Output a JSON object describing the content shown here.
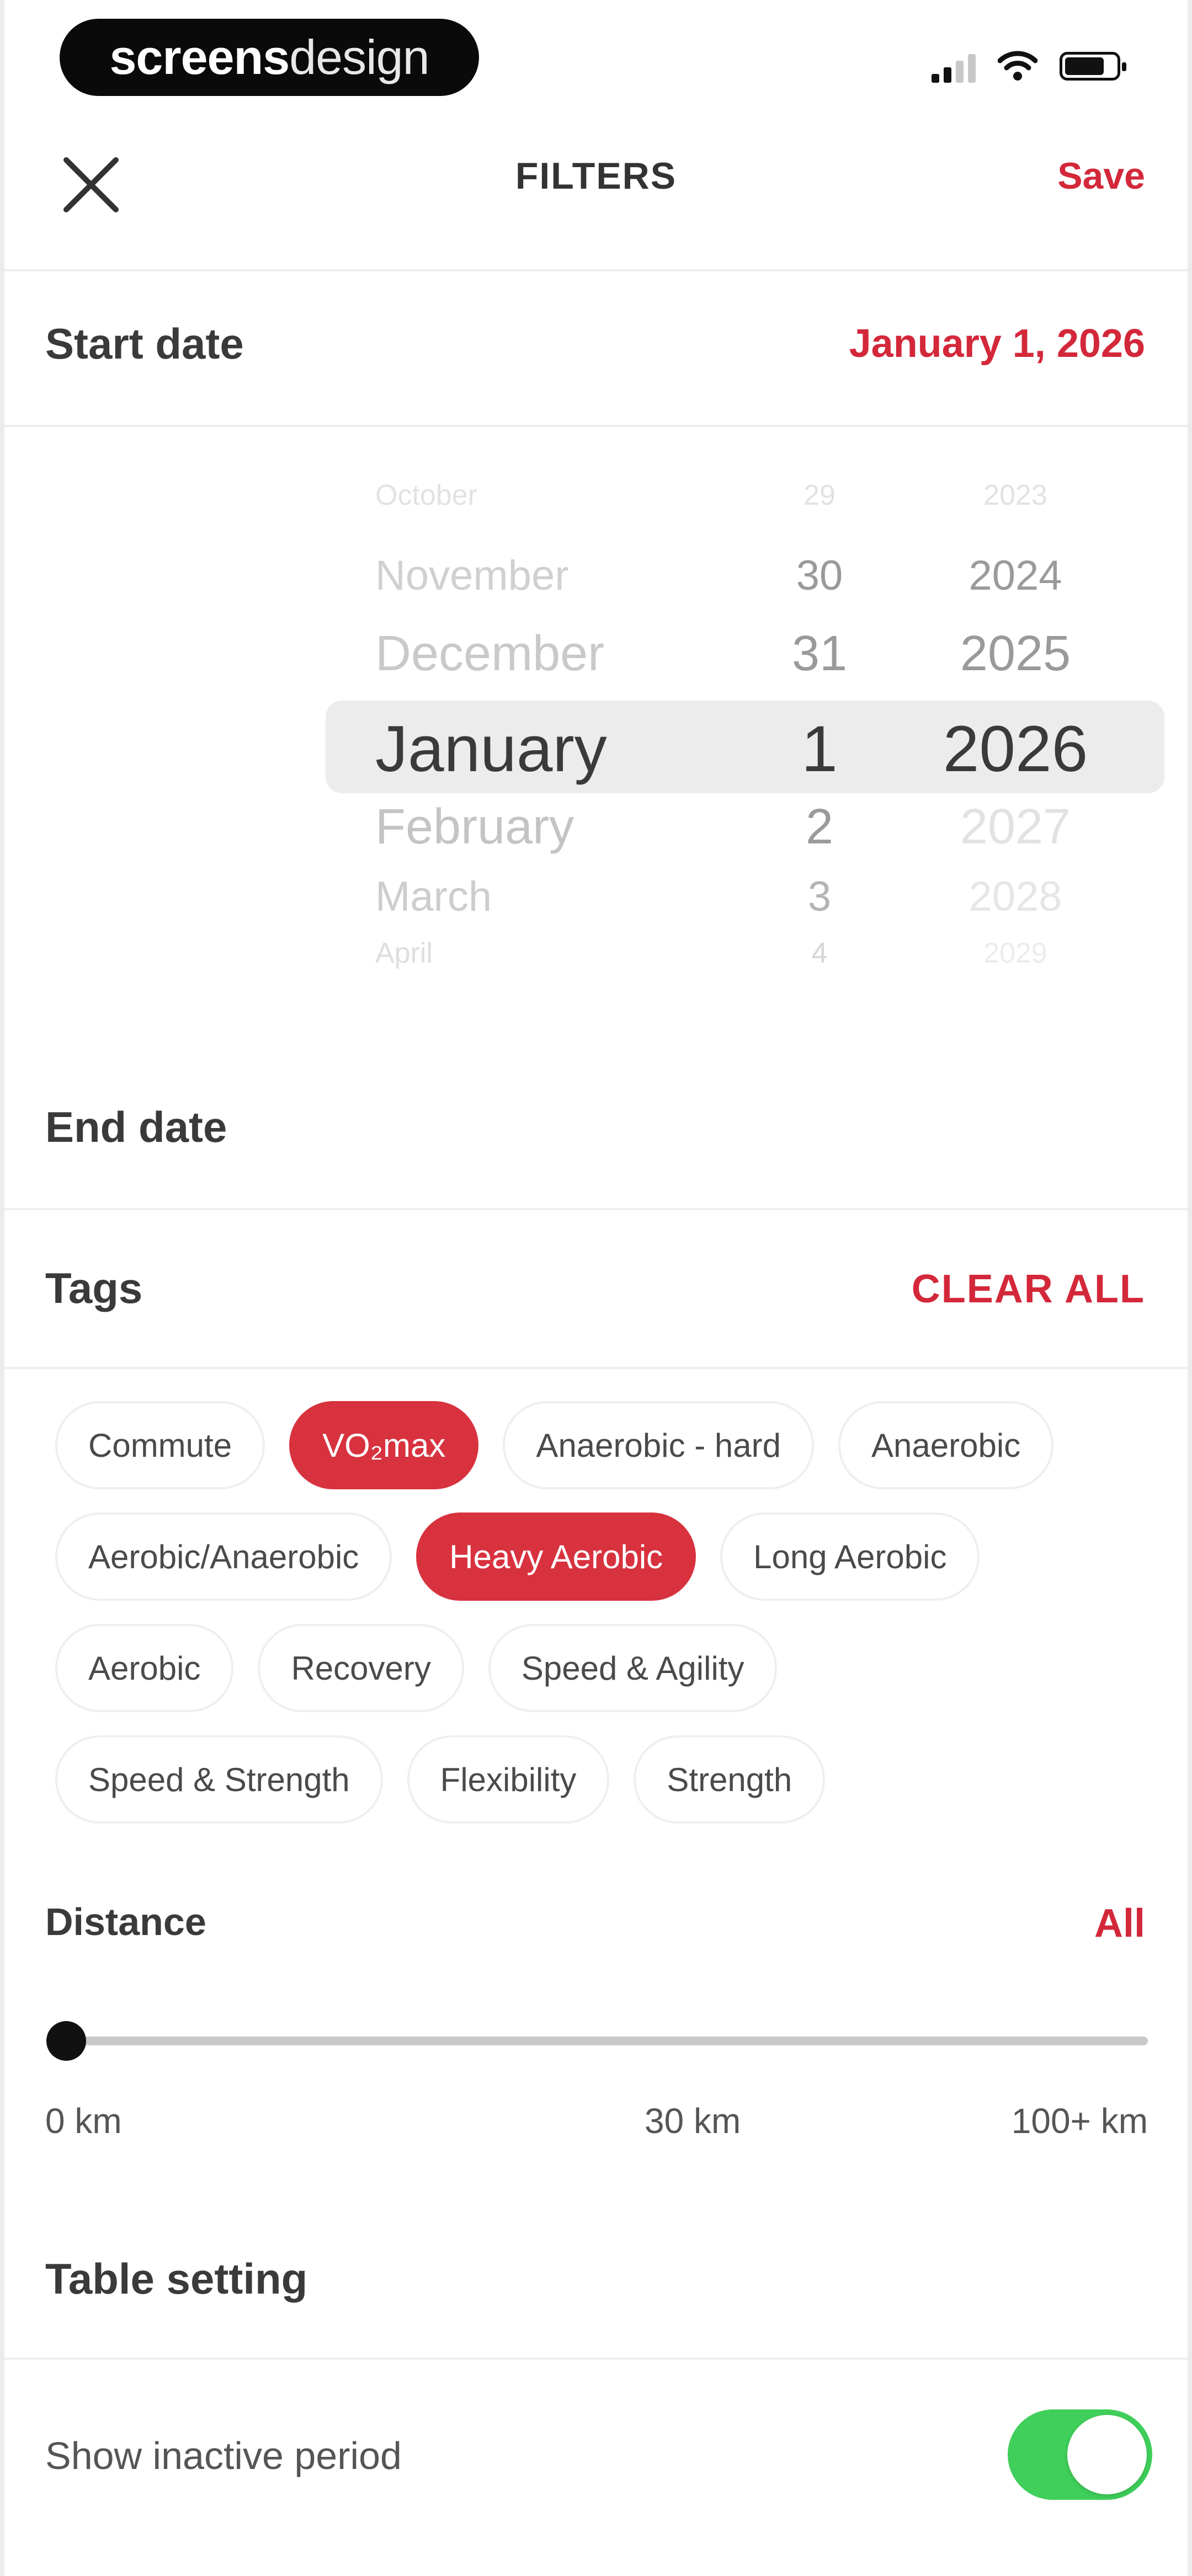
{
  "status_bar": {
    "brand_part1": "screens",
    "brand_part2": "design",
    "icons": [
      "cellular-signal-icon",
      "wifi-icon",
      "battery-icon"
    ]
  },
  "nav": {
    "title": "FILTERS",
    "save_label": "Save",
    "close_icon": "close-icon"
  },
  "start_date": {
    "label": "Start date",
    "value": "January 1, 2026"
  },
  "date_picker": {
    "months": [
      "October",
      "November",
      "December",
      "January",
      "February",
      "March",
      "April"
    ],
    "days": [
      "29",
      "30",
      "31",
      "1",
      "2",
      "3",
      "4"
    ],
    "years": [
      "2023",
      "2024",
      "2025",
      "2026",
      "2027",
      "2028",
      "2029"
    ],
    "selected": {
      "month": "January",
      "day": "1",
      "year": "2026"
    }
  },
  "end_date": {
    "label": "End date"
  },
  "tags": {
    "label": "Tags",
    "clear_label": "CLEAR ALL",
    "items": [
      {
        "label": "Commute",
        "selected": false
      },
      {
        "label": "VO₂max",
        "selected": true
      },
      {
        "label": "Anaerobic - hard",
        "selected": false
      },
      {
        "label": "Anaerobic",
        "selected": false
      },
      {
        "label": "Aerobic/Anaerobic",
        "selected": false
      },
      {
        "label": "Heavy Aerobic",
        "selected": true
      },
      {
        "label": "Long Aerobic",
        "selected": false
      },
      {
        "label": "Aerobic",
        "selected": false
      },
      {
        "label": "Recovery",
        "selected": false
      },
      {
        "label": "Speed & Agility",
        "selected": false
      },
      {
        "label": "Speed & Strength",
        "selected": false
      },
      {
        "label": "Flexibility",
        "selected": false
      },
      {
        "label": "Strength",
        "selected": false
      }
    ]
  },
  "distance": {
    "label": "Distance",
    "value_label": "All",
    "min_label": "0 km",
    "mid_label": "30 km",
    "max_label": "100+ km",
    "slider_fraction": 0.0
  },
  "table_setting": {
    "label": "Table setting",
    "show_inactive_label": "Show inactive period",
    "show_inactive_on": true
  },
  "colors": {
    "accent": "#d3283a",
    "toggle_on": "#3fcf5a"
  }
}
